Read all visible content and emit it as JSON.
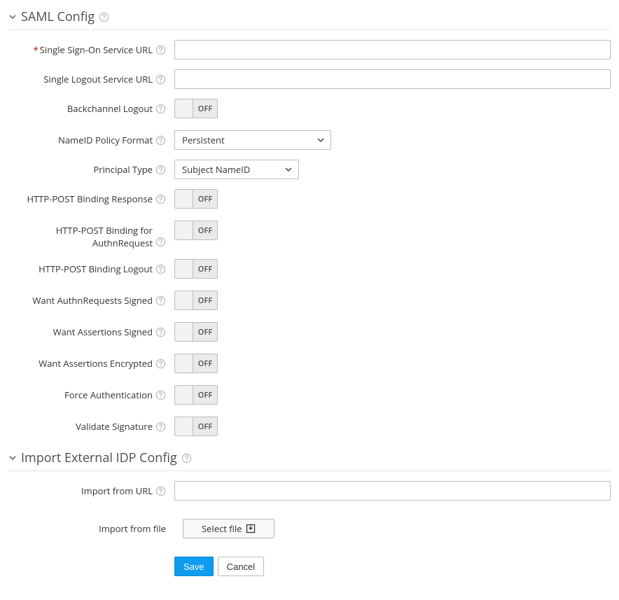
{
  "sections": {
    "saml": {
      "title": "SAML Config"
    },
    "import": {
      "title": "Import External IDP Config"
    }
  },
  "fields": {
    "ssoUrl": {
      "label": "Single Sign-On Service URL",
      "value": "",
      "required": true
    },
    "sloUrl": {
      "label": "Single Logout Service URL",
      "value": ""
    },
    "backchannel": {
      "label": "Backchannel Logout",
      "toggle": "OFF"
    },
    "nameIdPolicy": {
      "label": "NameID Policy Format",
      "value": "Persistent"
    },
    "principalType": {
      "label": "Principal Type",
      "value": "Subject NameID"
    },
    "httpPostResp": {
      "label": "HTTP-POST Binding Response",
      "toggle": "OFF"
    },
    "httpPostAuthn": {
      "label": "HTTP-POST Binding for AuthnRequest",
      "toggle": "OFF"
    },
    "httpPostLogout": {
      "label": "HTTP-POST Binding Logout",
      "toggle": "OFF"
    },
    "wantAuthnSigned": {
      "label": "Want AuthnRequests Signed",
      "toggle": "OFF"
    },
    "wantAssertSigned": {
      "label": "Want Assertions Signed",
      "toggle": "OFF"
    },
    "wantAssertEnc": {
      "label": "Want Assertions Encrypted",
      "toggle": "OFF"
    },
    "forceAuthn": {
      "label": "Force Authentication",
      "toggle": "OFF"
    },
    "validateSig": {
      "label": "Validate Signature",
      "toggle": "OFF"
    },
    "importUrl": {
      "label": "Import from URL",
      "value": ""
    },
    "importFile": {
      "label": "Import from file",
      "button": "Select file"
    }
  },
  "buttons": {
    "save": "Save",
    "cancel": "Cancel"
  },
  "requiredMark": "*"
}
